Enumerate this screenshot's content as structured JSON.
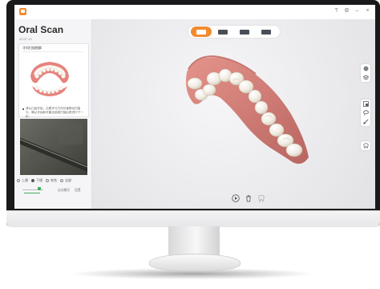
{
  "app": {
    "title": "Oral Scan",
    "version": "22.07.13"
  },
  "window_controls": [
    "?",
    "⚙",
    "–",
    "×"
  ],
  "sidebar": {
    "guide_card": {
      "header": "牙科扫描图解",
      "note": "请从臼齿开始，沿着牙弓方向匀速移动扫描头，确认牙齿和牙龈全部被扫描后再进行下一步。"
    },
    "scan_modes": [
      {
        "label": "上颌",
        "selected": false
      },
      {
        "label": "下颌",
        "selected": true
      },
      {
        "label": "咬合",
        "selected": false
      },
      {
        "label": "全部",
        "selected": false
      }
    ],
    "speed_level": 0.72,
    "bottom_labels": [
      "自动模式",
      "设置"
    ]
  },
  "viewer": {
    "toolbar_tabs": [
      {
        "icon": "upper-jaw-icon",
        "active": true
      },
      {
        "icon": "lower-jaw-icon",
        "active": false
      },
      {
        "icon": "both-jaws-icon",
        "active": false
      },
      {
        "icon": "bite-icon",
        "active": false
      }
    ],
    "right_tools_top": [
      "sphere-icon",
      "layers-icon"
    ],
    "right_tools_mid": [
      "crop-icon",
      "lasso-icon",
      "brush-icon"
    ],
    "right_tools_bottom": [
      "tooth-icon"
    ],
    "bottom_controls": [
      "play-icon",
      "trash-icon",
      "tooth-outline-icon"
    ]
  },
  "colors": {
    "accent": "#f28b30",
    "gum": "#d8837c",
    "tooth": "#f3efe6",
    "slider": "#3cae5c"
  }
}
